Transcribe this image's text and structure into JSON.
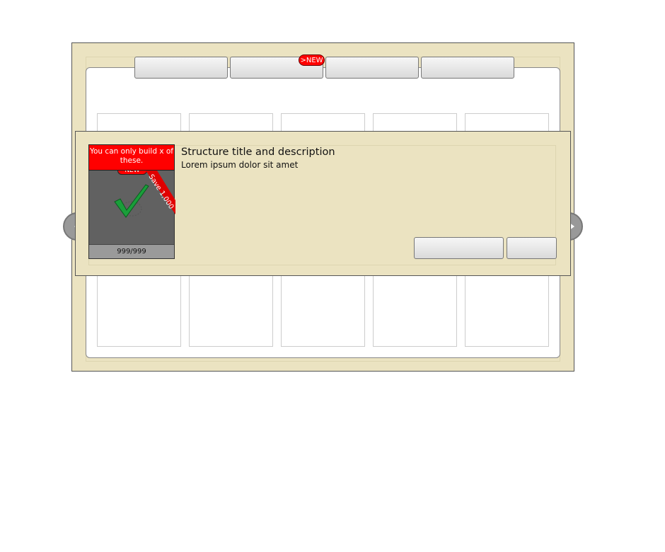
{
  "tabs": [
    {
      "label": ""
    },
    {
      "label": ""
    },
    {
      "label": ""
    },
    {
      "label": ""
    }
  ],
  "new_badge": ">NEW",
  "popup": {
    "warning": "You can only build x of these.",
    "ribbon": "Save 1,000",
    "corner_badge": "NEW",
    "count": "999/999",
    "title": "Structure title and description",
    "description": "Lorem ipsum dolor sit amet",
    "buttons": [
      {
        "label": ""
      },
      {
        "label": ""
      }
    ]
  },
  "colors": {
    "frame": "#ebe3c1",
    "alert": "#ff0000",
    "check": "#1a9e3a"
  }
}
